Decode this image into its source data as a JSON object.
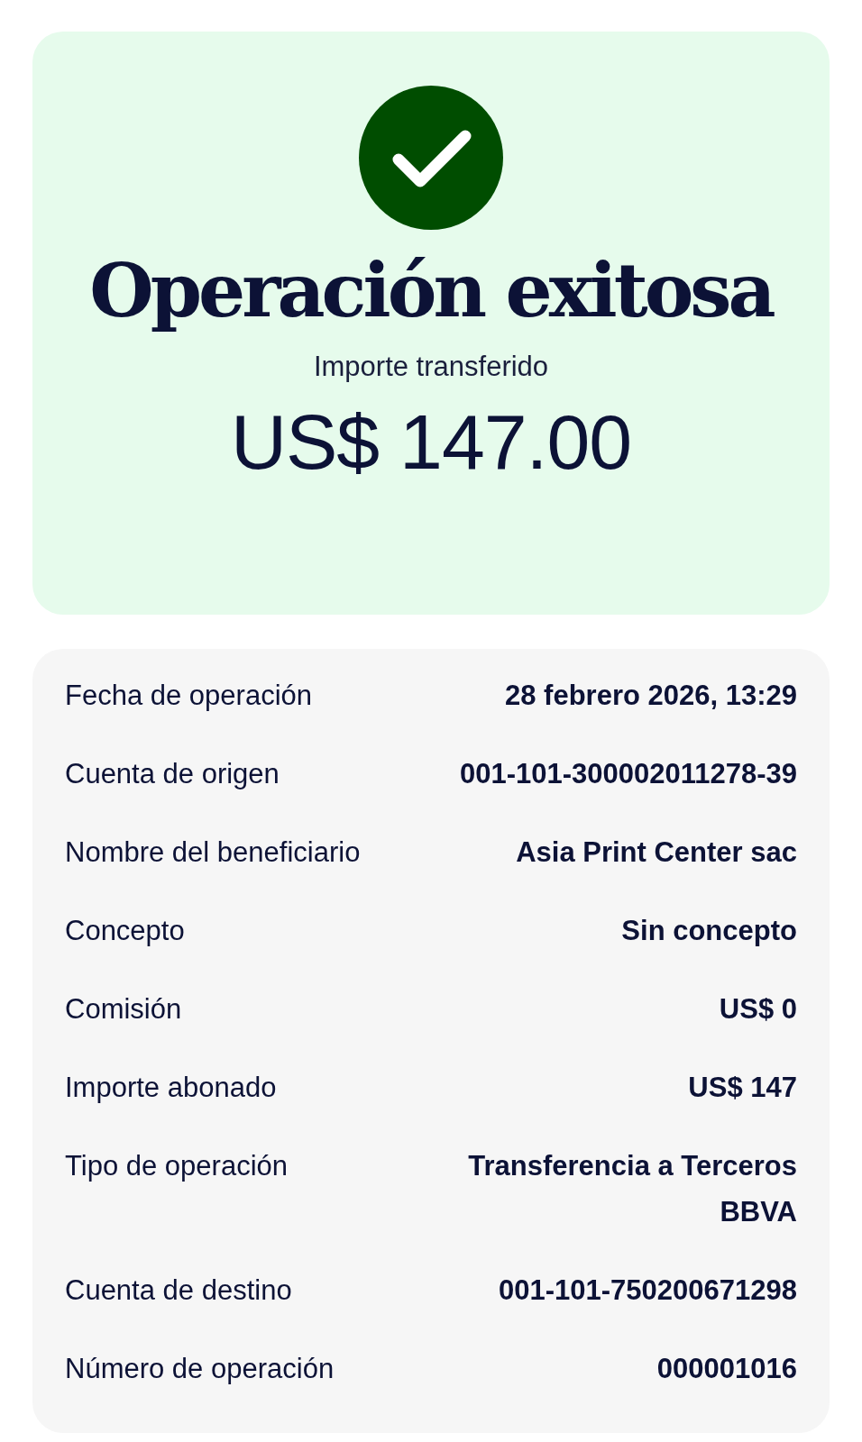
{
  "result": {
    "title": "Operación exitosa",
    "amount_label": "Importe transferido",
    "amount": "US$ 147.00"
  },
  "details": [
    {
      "label": "Fecha de operación",
      "value": [
        "28 febrero 2026, 13:29"
      ]
    },
    {
      "label": "Cuenta de origen",
      "value": [
        "001-101-300002011278-39"
      ]
    },
    {
      "label": "Nombre del beneficiario",
      "value": [
        "Asia Print Center sac"
      ]
    },
    {
      "label": "Concepto",
      "value": [
        "Sin concepto"
      ]
    },
    {
      "label": "Comisión",
      "value": [
        "US$ 0"
      ]
    },
    {
      "label": "Importe abonado",
      "value": [
        "US$ 147"
      ]
    },
    {
      "label": "Tipo de operación",
      "value": [
        "Transferencia a Terceros",
        "BBVA"
      ]
    },
    {
      "label": "Cuenta de destino",
      "value": [
        "001-101-750200671298"
      ]
    },
    {
      "label": "Número de operación",
      "value": [
        "000001016"
      ]
    }
  ]
}
